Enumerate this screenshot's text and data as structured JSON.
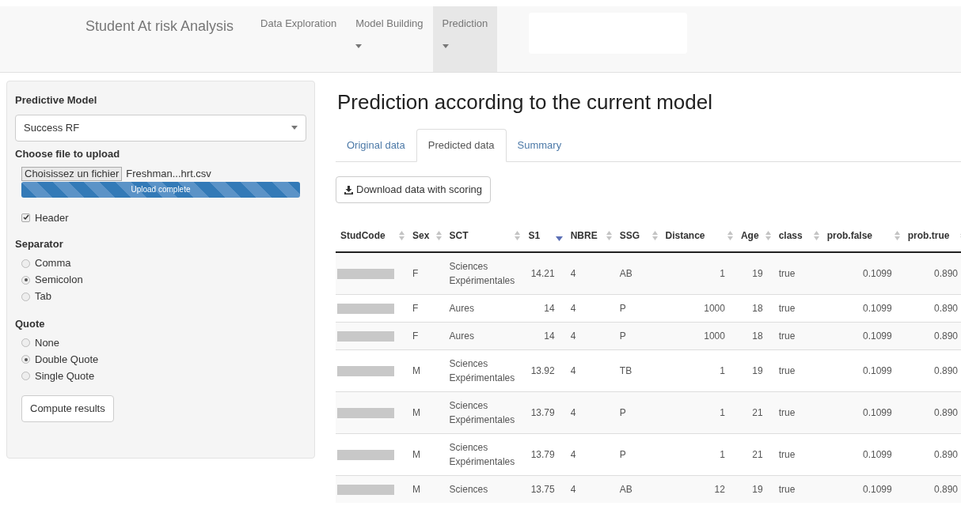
{
  "navbar": {
    "brand": "Student At risk Analysis",
    "items": [
      {
        "label": "Data Exploration",
        "dropdown": false,
        "selected": false
      },
      {
        "label": "Model Building",
        "dropdown": true,
        "selected": false
      },
      {
        "label": "Prediction",
        "dropdown": true,
        "selected": true
      }
    ]
  },
  "sidebar": {
    "model_label": "Predictive Model",
    "model_value": "Success RF",
    "file_label": "Choose file to upload",
    "file_button": "Choisissez un fichier",
    "file_name": "Freshman...hrt.csv",
    "progress": {
      "text": "Upload complete",
      "level": 1
    },
    "header_checkbox": {
      "label": "Header",
      "checked": true
    },
    "groups": [
      {
        "title": "Separator",
        "options": [
          {
            "label": "Comma",
            "selected": false
          },
          {
            "label": "Semicolon",
            "selected": true
          },
          {
            "label": "Tab",
            "selected": false
          }
        ]
      },
      {
        "title": "Quote",
        "options": [
          {
            "label": "None",
            "selected": false
          },
          {
            "label": "Double Quote",
            "selected": true
          },
          {
            "label": "Single Quote",
            "selected": false
          }
        ]
      }
    ],
    "compute_button": "Compute results"
  },
  "main": {
    "title": "Prediction according to the current model",
    "tabs": [
      {
        "label": "Original data",
        "selected": false
      },
      {
        "label": "Predicted data",
        "selected": true
      },
      {
        "label": "Summary",
        "selected": false
      }
    ],
    "download_button": "Download data with scoring",
    "table": {
      "columns": [
        {
          "label": "StudCode",
          "sorted": false
        },
        {
          "label": "Sex",
          "sorted": false
        },
        {
          "label": "SCT",
          "sorted": false
        },
        {
          "label": "S1",
          "sorted": true
        },
        {
          "label": "NBRE",
          "sorted": false
        },
        {
          "label": "SSG",
          "sorted": false
        },
        {
          "label": "Distance",
          "sorted": false
        },
        {
          "label": "Age",
          "sorted": false
        },
        {
          "label": "class",
          "sorted": false
        },
        {
          "label": "prob.false",
          "sorted": false
        },
        {
          "label": "prob.true",
          "sorted": false
        }
      ],
      "rows": [
        [
          "",
          "F",
          "Sciences Expérimentales",
          "14.21",
          "4",
          "AB",
          "1",
          "19",
          "true",
          "0.1099",
          "0.890"
        ],
        [
          "",
          "F",
          "Aures",
          "14",
          "4",
          "P",
          "1000",
          "18",
          "true",
          "0.1099",
          "0.890"
        ],
        [
          "",
          "F",
          "Aures",
          "14",
          "4",
          "P",
          "1000",
          "18",
          "true",
          "0.1099",
          "0.890"
        ],
        [
          "",
          "M",
          "Sciences Expérimentales",
          "13.92",
          "4",
          "TB",
          "1",
          "19",
          "true",
          "0.1099",
          "0.890"
        ],
        [
          "",
          "M",
          "Sciences Expérimentales",
          "13.79",
          "4",
          "P",
          "1",
          "21",
          "true",
          "0.1099",
          "0.890"
        ],
        [
          "",
          "M",
          "Sciences Expérimentales",
          "13.79",
          "4",
          "P",
          "1",
          "21",
          "true",
          "0.1099",
          "0.890"
        ],
        [
          "",
          "M",
          "Sciences",
          "13.75",
          "4",
          "AB",
          "12",
          "19",
          "true",
          "0.1099",
          "0.890"
        ]
      ]
    }
  }
}
